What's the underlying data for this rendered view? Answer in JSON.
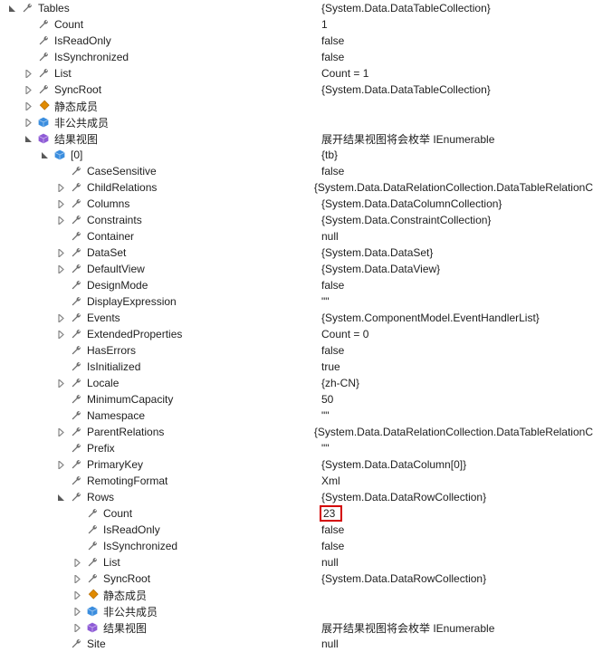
{
  "rows": [
    {
      "depth": 0,
      "toggle": "open",
      "icon": "wrench",
      "name": "Tables",
      "value": "{System.Data.DataTableCollection}"
    },
    {
      "depth": 1,
      "toggle": "none",
      "icon": "wrench",
      "name": "Count",
      "value": "1"
    },
    {
      "depth": 1,
      "toggle": "none",
      "icon": "wrench",
      "name": "IsReadOnly",
      "value": "false"
    },
    {
      "depth": 1,
      "toggle": "none",
      "icon": "wrench",
      "name": "IsSynchronized",
      "value": "false"
    },
    {
      "depth": 1,
      "toggle": "closed",
      "icon": "wrench",
      "name": "List",
      "value": "Count = 1"
    },
    {
      "depth": 1,
      "toggle": "closed",
      "icon": "wrench",
      "name": "SyncRoot",
      "value": "{System.Data.DataTableCollection}"
    },
    {
      "depth": 1,
      "toggle": "closed",
      "icon": "diamond",
      "name": "静态成员",
      "value": ""
    },
    {
      "depth": 1,
      "toggle": "closed",
      "icon": "cube-blue",
      "name": "非公共成员",
      "value": ""
    },
    {
      "depth": 1,
      "toggle": "open",
      "icon": "cube-purple",
      "name": "结果视图",
      "value": "展开结果视图将会枚举 IEnumerable"
    },
    {
      "depth": 2,
      "toggle": "open",
      "icon": "cube-blue",
      "name": "[0]",
      "value": "{tb}"
    },
    {
      "depth": 3,
      "toggle": "none",
      "icon": "wrench",
      "name": "CaseSensitive",
      "value": "false"
    },
    {
      "depth": 3,
      "toggle": "closed",
      "icon": "wrench",
      "name": "ChildRelations",
      "value": "{System.Data.DataRelationCollection.DataTableRelationC"
    },
    {
      "depth": 3,
      "toggle": "closed",
      "icon": "wrench",
      "name": "Columns",
      "value": "{System.Data.DataColumnCollection}"
    },
    {
      "depth": 3,
      "toggle": "closed",
      "icon": "wrench",
      "name": "Constraints",
      "value": "{System.Data.ConstraintCollection}"
    },
    {
      "depth": 3,
      "toggle": "none",
      "icon": "wrench",
      "name": "Container",
      "value": "null"
    },
    {
      "depth": 3,
      "toggle": "closed",
      "icon": "wrench",
      "name": "DataSet",
      "value": "{System.Data.DataSet}"
    },
    {
      "depth": 3,
      "toggle": "closed",
      "icon": "wrench",
      "name": "DefaultView",
      "value": "{System.Data.DataView}"
    },
    {
      "depth": 3,
      "toggle": "none",
      "icon": "wrench",
      "name": "DesignMode",
      "value": "false"
    },
    {
      "depth": 3,
      "toggle": "none",
      "icon": "wrench",
      "name": "DisplayExpression",
      "value": "\"\""
    },
    {
      "depth": 3,
      "toggle": "closed",
      "icon": "wrench",
      "name": "Events",
      "value": "{System.ComponentModel.EventHandlerList}"
    },
    {
      "depth": 3,
      "toggle": "closed",
      "icon": "wrench",
      "name": "ExtendedProperties",
      "value": "Count = 0"
    },
    {
      "depth": 3,
      "toggle": "none",
      "icon": "wrench",
      "name": "HasErrors",
      "value": "false"
    },
    {
      "depth": 3,
      "toggle": "none",
      "icon": "wrench",
      "name": "IsInitialized",
      "value": "true"
    },
    {
      "depth": 3,
      "toggle": "closed",
      "icon": "wrench",
      "name": "Locale",
      "value": "{zh-CN}"
    },
    {
      "depth": 3,
      "toggle": "none",
      "icon": "wrench",
      "name": "MinimumCapacity",
      "value": "50"
    },
    {
      "depth": 3,
      "toggle": "none",
      "icon": "wrench",
      "name": "Namespace",
      "value": "\"\""
    },
    {
      "depth": 3,
      "toggle": "closed",
      "icon": "wrench",
      "name": "ParentRelations",
      "value": "{System.Data.DataRelationCollection.DataTableRelationC"
    },
    {
      "depth": 3,
      "toggle": "none",
      "icon": "wrench",
      "name": "Prefix",
      "value": "\"\""
    },
    {
      "depth": 3,
      "toggle": "closed",
      "icon": "wrench",
      "name": "PrimaryKey",
      "value": "{System.Data.DataColumn[0]}"
    },
    {
      "depth": 3,
      "toggle": "none",
      "icon": "wrench",
      "name": "RemotingFormat",
      "value": "Xml"
    },
    {
      "depth": 3,
      "toggle": "open",
      "icon": "wrench",
      "name": "Rows",
      "value": "{System.Data.DataRowCollection}"
    },
    {
      "depth": 4,
      "toggle": "none",
      "icon": "wrench",
      "name": "Count",
      "value": "23",
      "highlight": true
    },
    {
      "depth": 4,
      "toggle": "none",
      "icon": "wrench",
      "name": "IsReadOnly",
      "value": "false"
    },
    {
      "depth": 4,
      "toggle": "none",
      "icon": "wrench",
      "name": "IsSynchronized",
      "value": "false"
    },
    {
      "depth": 4,
      "toggle": "closed",
      "icon": "wrench",
      "name": "List",
      "value": "null"
    },
    {
      "depth": 4,
      "toggle": "closed",
      "icon": "wrench",
      "name": "SyncRoot",
      "value": "{System.Data.DataRowCollection}"
    },
    {
      "depth": 4,
      "toggle": "closed",
      "icon": "diamond",
      "name": "静态成员",
      "value": ""
    },
    {
      "depth": 4,
      "toggle": "closed",
      "icon": "cube-blue",
      "name": "非公共成员",
      "value": ""
    },
    {
      "depth": 4,
      "toggle": "closed",
      "icon": "cube-purple",
      "name": "结果视图",
      "value": "展开结果视图将会枚举 IEnumerable"
    },
    {
      "depth": 3,
      "toggle": "none",
      "icon": "wrench",
      "name": "Site",
      "value": "null"
    }
  ],
  "watermark": ""
}
